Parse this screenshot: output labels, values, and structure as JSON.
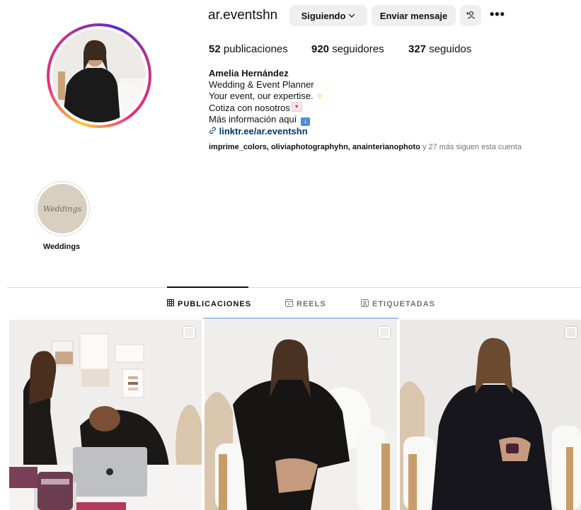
{
  "profile": {
    "username": "ar.eventshn",
    "buttons": {
      "following": "Siguiendo",
      "message": "Enviar mensaje"
    },
    "stats": {
      "posts_count": "52",
      "posts_label": "publicaciones",
      "followers_count": "920",
      "followers_label": "seguidores",
      "following_count": "327",
      "following_label": "seguidos"
    },
    "bio": {
      "name": "Amelia Hernández",
      "line1": "Wedding & Event Planner",
      "line2": "Your event, our expertise.",
      "line3": "Cotiza con nosotros",
      "line4": "Más información aquí",
      "link": "linktr.ee/ar.eventshn"
    },
    "followed_by": {
      "names": "imprime_colors, oliviaphotographyhn, anainterianophoto",
      "suffix": "y 27 más siguen esta cuenta"
    }
  },
  "highlights": [
    {
      "label": "Weddings",
      "cover_text": "Weddings"
    }
  ],
  "tabs": [
    {
      "label": "PUBLICACIONES",
      "icon": "grid-icon",
      "active": true
    },
    {
      "label": "REELS",
      "icon": "reels-icon",
      "active": false
    },
    {
      "label": "ETIQUETADAS",
      "icon": "tagged-icon",
      "active": false
    }
  ],
  "colors": {
    "link": "#00376b",
    "button_bg": "#efefef",
    "muted_text": "#737373"
  }
}
